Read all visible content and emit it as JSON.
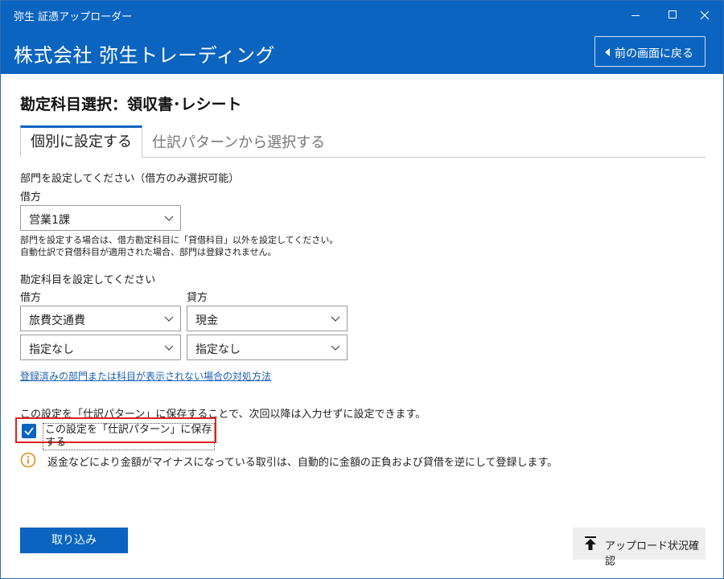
{
  "window": {
    "app_title": "弥生 証憑アップローダー",
    "controls": {
      "minimize": "—",
      "maximize": "☐",
      "close": "✕"
    }
  },
  "header": {
    "company": "株式会社 弥生トレーディング",
    "back_button": "前の画面に戻る"
  },
  "page": {
    "title": "勘定科目選択：領収書･レシート"
  },
  "tabs": [
    {
      "label": "個別に設定する",
      "active": true
    },
    {
      "label": "仕訳パターンから選択する",
      "active": false
    }
  ],
  "department": {
    "heading": "部門を設定してください（借方のみ選択可能）",
    "debit_label": "借方",
    "selected": "営業1課",
    "note_line1": "部門を設定する場合は、借方勘定科目に「貸借科目」以外を設定してください。",
    "note_line2": "自動仕訳で貸借科目が適用された場合、部門は登録されません。"
  },
  "accounts": {
    "heading": "勘定科目を設定してください",
    "debit_label": "借方",
    "credit_label": "貸方",
    "debit_account": "旅費交通費",
    "credit_account": "現金",
    "debit_sub": "指定なし",
    "credit_sub": "指定なし"
  },
  "help_link": "登録済みの部門または科目が表示されない場合の対処方法",
  "pattern": {
    "description": "この設定を「仕訳パターン」に保存することで、次回以降は入力せずに設定できます。",
    "checkbox_label": "この設定を「仕訳パターン」に保存する",
    "checked": true
  },
  "info": {
    "text": "返金などにより金額がマイナスになっている取引は、自動的に金額の正負および貸借を逆にして登録します。",
    "icon_color": "#e8891d"
  },
  "footer": {
    "import_button": "取り込み",
    "upload_status_button": "アップロード状況確認"
  },
  "colors": {
    "brand_blue": "#0a64c0",
    "highlight_red": "#e02020",
    "link_blue": "#1a5fb4"
  }
}
